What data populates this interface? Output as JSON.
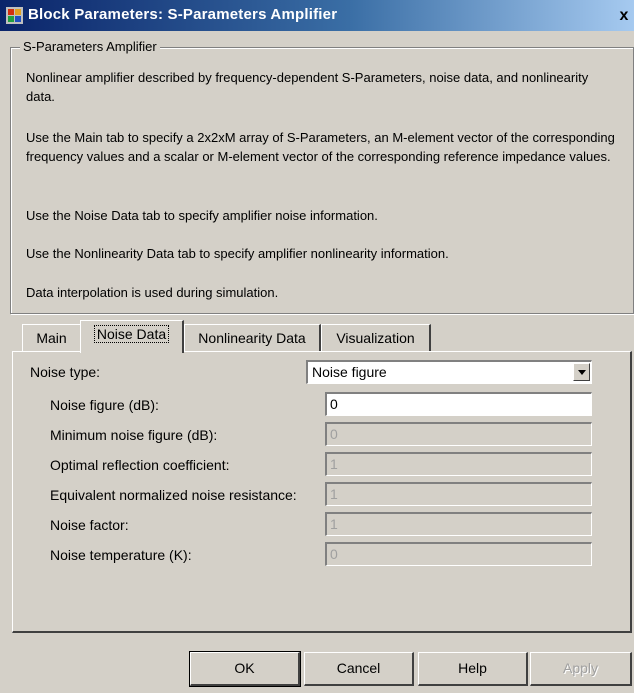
{
  "window": {
    "title": "Block Parameters: S-Parameters Amplifier",
    "close_glyph": "x"
  },
  "group": {
    "legend": "S-Parameters Amplifier",
    "paragraphs": [
      "Nonlinear amplifier described by frequency-dependent S-Parameters, noise data, and nonlinearity data.",
      "Use the Main tab to specify a 2x2xM array of S-Parameters, an M-element vector of the corresponding frequency values and a scalar or M-element vector of the corresponding reference impedance values.",
      "Use the Noise Data tab to specify amplifier noise information.",
      "Use the Nonlinearity Data tab to specify amplifier nonlinearity information.",
      "Data interpolation is used during simulation."
    ]
  },
  "tabs": [
    {
      "label": "Main"
    },
    {
      "label": "Noise Data"
    },
    {
      "label": "Nonlinearity Data"
    },
    {
      "label": "Visualization"
    }
  ],
  "active_tab": "Noise Data",
  "noise": {
    "type_label": "Noise type:",
    "type_value": "Noise figure",
    "fields": [
      {
        "label": "Noise figure (dB):",
        "value": "0",
        "enabled": true
      },
      {
        "label": "Minimum noise figure (dB):",
        "value": "0",
        "enabled": false
      },
      {
        "label": "Optimal reflection coefficient:",
        "value": "1",
        "enabled": false
      },
      {
        "label": "Equivalent normalized noise resistance:",
        "value": "1",
        "enabled": false
      },
      {
        "label": "Noise factor:",
        "value": "1",
        "enabled": false
      },
      {
        "label": "Noise temperature (K):",
        "value": "0",
        "enabled": false
      }
    ]
  },
  "buttons": {
    "ok": "OK",
    "cancel": "Cancel",
    "help": "Help",
    "apply": "Apply"
  },
  "colors": {
    "dialog_bg": "#d4d0c8",
    "titlebar_start": "#0a246a",
    "titlebar_end": "#a6caf0",
    "disabled_text": "#a0a0a0"
  }
}
